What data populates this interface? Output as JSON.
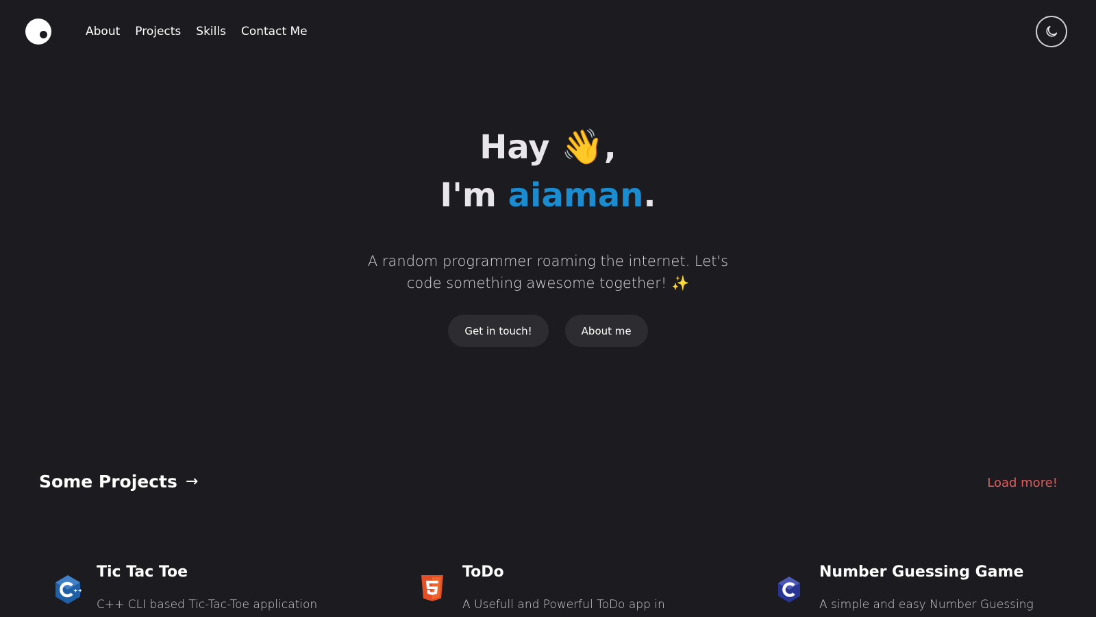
{
  "nav": {
    "items": [
      {
        "label": "About"
      },
      {
        "label": "Projects"
      },
      {
        "label": "Skills"
      },
      {
        "label": "Contact Me"
      }
    ],
    "theme_icon": "moon-icon"
  },
  "hero": {
    "greeting": "Hay",
    "wave_emoji": "👋",
    "greeting_suffix": ",",
    "intro_prefix": "I'm ",
    "name": "aiaman",
    "intro_suffix": ".",
    "subtitle_line1": "A random programmer roaming the internet. Let's",
    "subtitle_line2": "code something awesome together! ✨",
    "buttons": {
      "contact": "Get in touch!",
      "about": "About me"
    },
    "name_color": "#1a8ccf"
  },
  "projects": {
    "heading": "Some Projects",
    "heading_arrow": "→",
    "load_more": "Load more!",
    "load_more_color": "#e45b5b",
    "items": [
      {
        "title": "Tic Tac Toe",
        "description": "C++ CLI based Tic-Tac-Toe application",
        "icon": "cpp-icon"
      },
      {
        "title": "ToDo",
        "description": "A Usefull and Powerful ToDo app in",
        "icon": "html5-icon"
      },
      {
        "title": "Number Guessing Game",
        "description": "A simple and easy Number Guessing",
        "icon": "c-icon"
      }
    ]
  }
}
